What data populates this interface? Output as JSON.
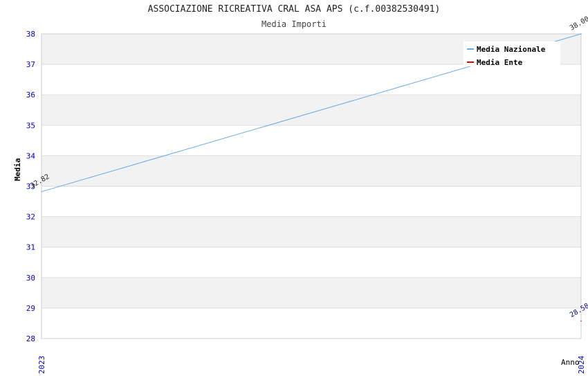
{
  "chart_data": {
    "type": "line",
    "title": "ASSOCIAZIONE RICREATIVA CRAL ASA APS (c.f.00382530491)",
    "subtitle": "Media Importi",
    "xlabel": "Anno",
    "ylabel": "Media",
    "categories": [
      "2023",
      "2024"
    ],
    "ylim": [
      28,
      38
    ],
    "yticks": [
      28,
      29,
      30,
      31,
      32,
      33,
      34,
      35,
      36,
      37,
      38
    ],
    "grid": "horizontal bands",
    "legend_position": "top-right",
    "series": [
      {
        "name": "Media Nazionale",
        "color": "#66aaee",
        "values": [
          32.82,
          38.0
        ],
        "labels": [
          "32.82",
          "38.00"
        ]
      },
      {
        "name": "Media Ente",
        "color": "#dd0000",
        "values": [
          null,
          28.58
        ],
        "labels": [
          "",
          "28.58"
        ]
      }
    ],
    "colors": {
      "tick_label": "#0000cc",
      "band": "#f2f2f2",
      "grid": "#dddddd"
    }
  }
}
